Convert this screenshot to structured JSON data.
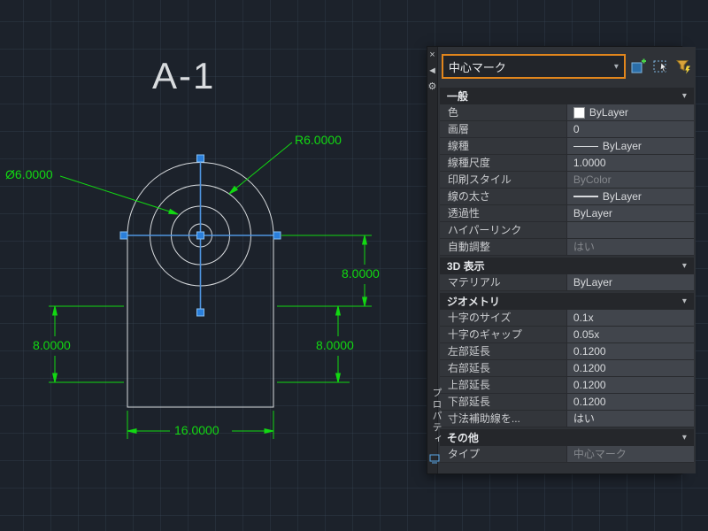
{
  "canvas": {
    "title": "A-1",
    "dimensions": {
      "radius": "R6.0000",
      "diameter": "Ø6.0000",
      "right_height": "8.0000",
      "left_height": "8.0000",
      "mid_height": "8.0000",
      "width": "16.0000"
    },
    "colors": {
      "dimension_green": "#12d812",
      "geometry_white": "#d9dcdf",
      "center_mark_blue": "#4f94e0",
      "grip_blue": "#2a7fdb",
      "selection_accent_orange": "#e2861c"
    }
  },
  "palette": {
    "selector": {
      "value": "中心マーク",
      "arrow": "▾"
    },
    "side": {
      "close": "×",
      "autohide": "◄",
      "menu": "⚙",
      "title_vertical": "プロパティ"
    },
    "toolbar_icons": [
      "toggle-pickadd-icon",
      "select-objects-icon",
      "quick-select-icon"
    ],
    "sections": [
      {
        "title": "一般",
        "chevron": "▾",
        "rows": [
          {
            "label": "色",
            "value": "ByLayer"
          },
          {
            "label": "画層",
            "value": "0"
          },
          {
            "label": "線種",
            "value": "ByLayer"
          },
          {
            "label": "線種尺度",
            "value": "1.0000"
          },
          {
            "label": "印刷スタイル",
            "value": "ByColor"
          },
          {
            "label": "線の太さ",
            "value": "ByLayer"
          },
          {
            "label": "透過性",
            "value": "ByLayer"
          },
          {
            "label": "ハイパーリンク",
            "value": ""
          },
          {
            "label": "自動調整",
            "value": "はい"
          }
        ]
      },
      {
        "title": "3D 表示",
        "chevron": "▾",
        "rows": [
          {
            "label": "マテリアル",
            "value": "ByLayer"
          }
        ]
      },
      {
        "title": "ジオメトリ",
        "chevron": "▾",
        "rows": [
          {
            "label": "十字のサイズ",
            "value": "0.1x"
          },
          {
            "label": "十字のギャップ",
            "value": "0.05x"
          },
          {
            "label": "左部延長",
            "value": "0.1200"
          },
          {
            "label": "右部延長",
            "value": "0.1200"
          },
          {
            "label": "上部延長",
            "value": "0.1200"
          },
          {
            "label": "下部延長",
            "value": "0.1200"
          },
          {
            "label": "寸法補助線を...",
            "value": "はい"
          }
        ]
      },
      {
        "title": "その他",
        "chevron": "▾",
        "rows": [
          {
            "label": "タイプ",
            "value": "中心マーク"
          }
        ]
      }
    ]
  }
}
